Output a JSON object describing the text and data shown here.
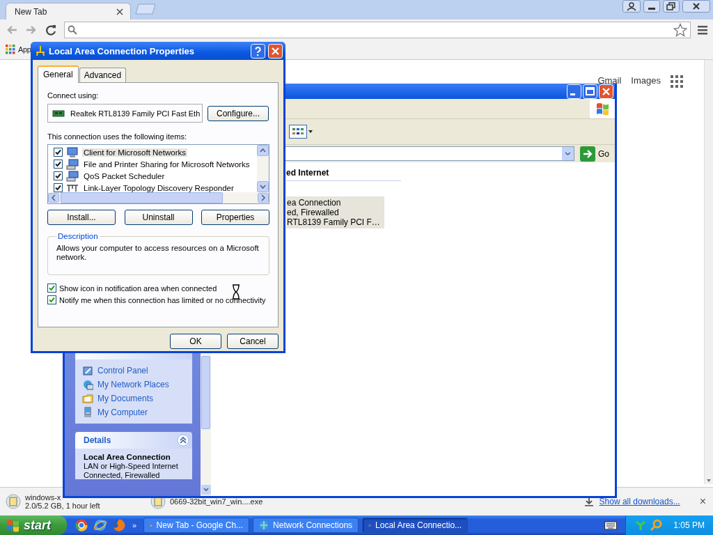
{
  "browser": {
    "tabs": [
      {
        "label": "New Tab",
        "selected": true
      }
    ],
    "bookmarks": [
      {
        "label": "App"
      }
    ],
    "top_links": [
      "Gmail",
      "Images"
    ],
    "downloads": [
      {
        "name": "windows-x",
        "status": "2.0/5.2 GB, 1 hour left"
      },
      {
        "name": "0669-32bit_win7_win....exe"
      }
    ],
    "show_all": "Show all downloads...",
    "close": "×"
  },
  "explorer": {
    "go": "Go",
    "group_heading": "ed Internet",
    "connection": {
      "lines": [
        "ea Connection",
        "ed, Firewalled",
        "RTL8139 Family PCI F…"
      ],
      "selected": true
    },
    "other_places": [
      "Control Panel",
      "My Network Places",
      "My Documents",
      "My Computer"
    ],
    "details": {
      "title": "Details",
      "expanded": true,
      "name": "Local Area Connection",
      "lines": [
        "LAN or High-Speed Internet",
        "Connected, Firewalled"
      ]
    }
  },
  "dialog": {
    "title": "Local Area Connection Properties",
    "tabs": [
      {
        "label": "General",
        "selected": true
      },
      {
        "label": "Advanced",
        "selected": false
      }
    ],
    "connect_using_label": "Connect using:",
    "adapter": "Realtek RTL8139 Family PCI Fast Eth",
    "configure": "Configure...",
    "items_label": "This connection uses the following items:",
    "items": [
      {
        "kind": "client",
        "label": "Client for Microsoft Networks",
        "checked": true,
        "selected": true
      },
      {
        "kind": "service",
        "label": "File and Printer Sharing for Microsoft Networks",
        "checked": true,
        "selected": false
      },
      {
        "kind": "service",
        "label": "QoS Packet Scheduler",
        "checked": true,
        "selected": false
      },
      {
        "kind": "protocol",
        "label": "Link-Layer Topology Discovery Responder",
        "checked": true,
        "selected": false
      }
    ],
    "item_buttons": [
      "Install...",
      "Uninstall",
      "Properties"
    ],
    "description": {
      "title": "Description",
      "text": "Allows your computer to access resources on a Microsoft network."
    },
    "options": [
      {
        "label": "Show icon in notification area when connected",
        "checked": true
      },
      {
        "label": "Notify me when this connection has limited or no connectivity",
        "checked": true
      }
    ],
    "buttons": [
      "OK",
      "Cancel"
    ]
  },
  "taskbar": {
    "start": "start",
    "more": "»",
    "tasks": [
      {
        "kind": "browser",
        "label": "New Tab - Google Ch...",
        "selected": false
      },
      {
        "kind": "network",
        "label": "Network Connections",
        "selected": false
      },
      {
        "kind": "properties",
        "label": "Local Area Connectio...",
        "selected": true
      }
    ],
    "clock": "1:05 PM"
  }
}
